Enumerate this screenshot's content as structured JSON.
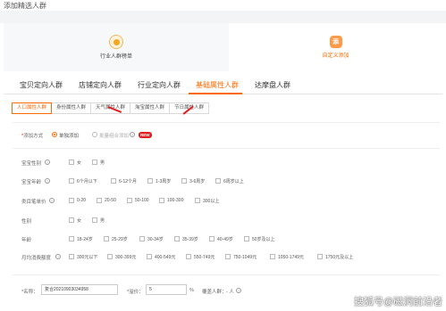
{
  "page_title": "添加精选人群",
  "top_cards": [
    {
      "label": "行业人群榜单",
      "icon": "medal-icon"
    },
    {
      "label": "自定义添加",
      "icon": "custom-add-icon",
      "icon_text": "添",
      "active": true
    }
  ],
  "main_tabs": [
    "宝贝定向人群",
    "店铺定向人群",
    "行业定向人群",
    "基础属性人群",
    "达摩盘人群"
  ],
  "active_main_tab": "基础属性人群",
  "sub_tabs": [
    "人口属性人群",
    "身份属性人群",
    "天气属性人群",
    "淘宝属性人群",
    "节日属性人群"
  ],
  "active_sub_tab": "人口属性人群",
  "add_method": {
    "required_mark": "*",
    "label": "添加方式",
    "options": [
      "单独添加",
      "批量组合添加"
    ],
    "selected": "单独添加",
    "badge": "NEW"
  },
  "filters": [
    {
      "key": "gender",
      "label": "宝宝性别",
      "help": true,
      "options": [
        "女",
        "男"
      ]
    },
    {
      "key": "age",
      "label": "宝宝年龄",
      "help": true,
      "options": [
        "6个月以下",
        "6-12个月",
        "1-3周岁",
        "3-6周岁",
        "6周岁以上"
      ]
    },
    {
      "key": "price",
      "label": "类目笔单价",
      "help": true,
      "options": [
        "0-20",
        "20-50",
        "50-100",
        "100-300",
        "300以上"
      ]
    },
    {
      "key": "sex",
      "label": "性别",
      "help": false,
      "options": [
        "女",
        "男"
      ]
    },
    {
      "key": "age_range",
      "label": "年龄",
      "help": false,
      "options": [
        "18-24岁",
        "25-29岁",
        "30-34岁",
        "35-39岁",
        "40-49岁",
        "50岁及以上"
      ]
    },
    {
      "key": "spend",
      "label": "月均消费额度",
      "help": true,
      "options": [
        "300元以下",
        "300-399元",
        "400-549元",
        "550-749元",
        "750-1049元",
        "1050-1749元",
        "1750元及以上"
      ]
    }
  ],
  "footer": {
    "name_label": "*名称：",
    "name_value": "复合20210903034958",
    "premium_label": "*溢价：",
    "premium_value": "5",
    "premium_unit": "%",
    "coverage_label": "覆盖人群：",
    "coverage_value": "- 人",
    "coverage_help": "?"
  },
  "watermark": "搜狐号@磁洞前沿者"
}
